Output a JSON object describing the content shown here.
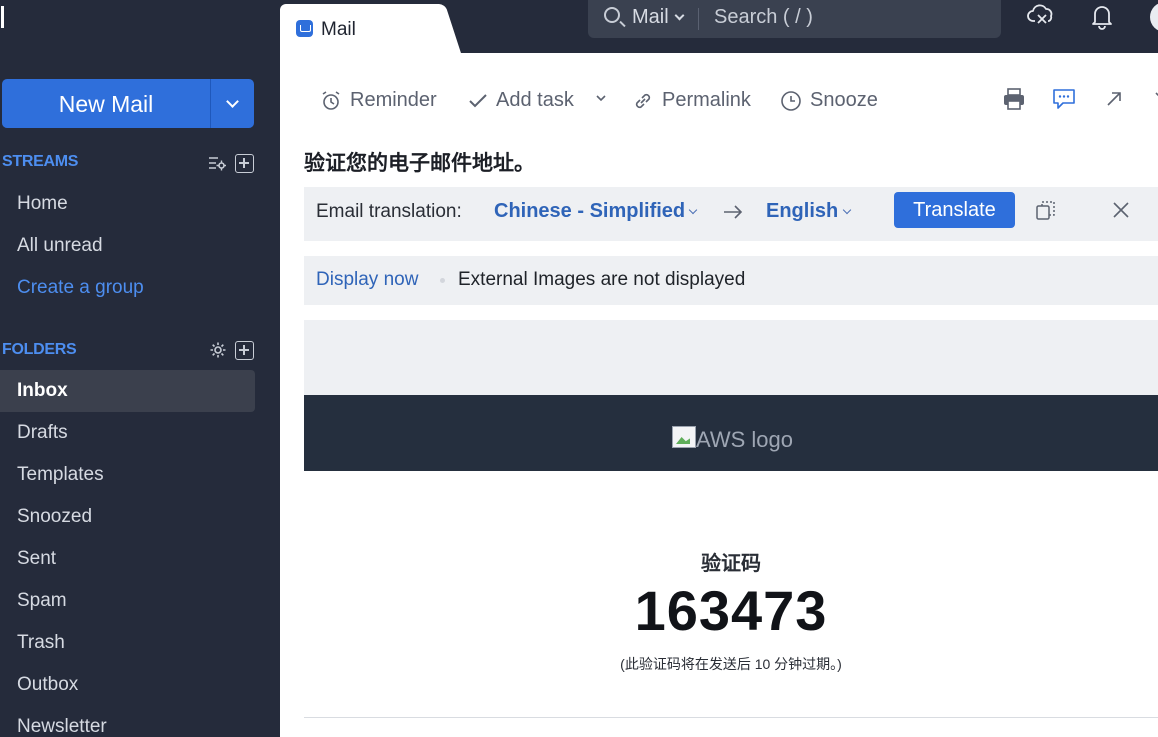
{
  "tab": {
    "label": "Mail"
  },
  "search": {
    "scope": "Mail",
    "placeholder": "Search ( / )"
  },
  "sidebar": {
    "new_mail_label": "New Mail",
    "streams_heading": "STREAMS",
    "streams": [
      {
        "label": "Home"
      },
      {
        "label": "All unread"
      },
      {
        "label": "Create a group"
      }
    ],
    "folders_heading": "FOLDERS",
    "folders": [
      {
        "label": "Inbox",
        "active": true
      },
      {
        "label": "Drafts"
      },
      {
        "label": "Templates"
      },
      {
        "label": "Snoozed"
      },
      {
        "label": "Sent"
      },
      {
        "label": "Spam"
      },
      {
        "label": "Trash"
      },
      {
        "label": "Outbox"
      },
      {
        "label": "Newsletter"
      }
    ]
  },
  "toolbar": {
    "reminder": "Reminder",
    "add_task": "Add task",
    "permalink": "Permalink",
    "snooze": "Snooze"
  },
  "email": {
    "subject": "验证您的电子邮件地址。",
    "translation": {
      "label": "Email translation:",
      "from": "Chinese - Simplified",
      "to": "English",
      "button": "Translate"
    },
    "images": {
      "action": "Display now",
      "message": "External Images are not displayed"
    },
    "logo_alt": "AWS logo",
    "code_label": "验证码",
    "code": "163473",
    "code_note": "(此验证码将在发送后 10 分钟过期。)"
  },
  "colors": {
    "sidebar_bg": "#252b3b",
    "accent": "#2f6fdb",
    "link": "#2f64b8",
    "banner_bg": "#252f3e"
  }
}
